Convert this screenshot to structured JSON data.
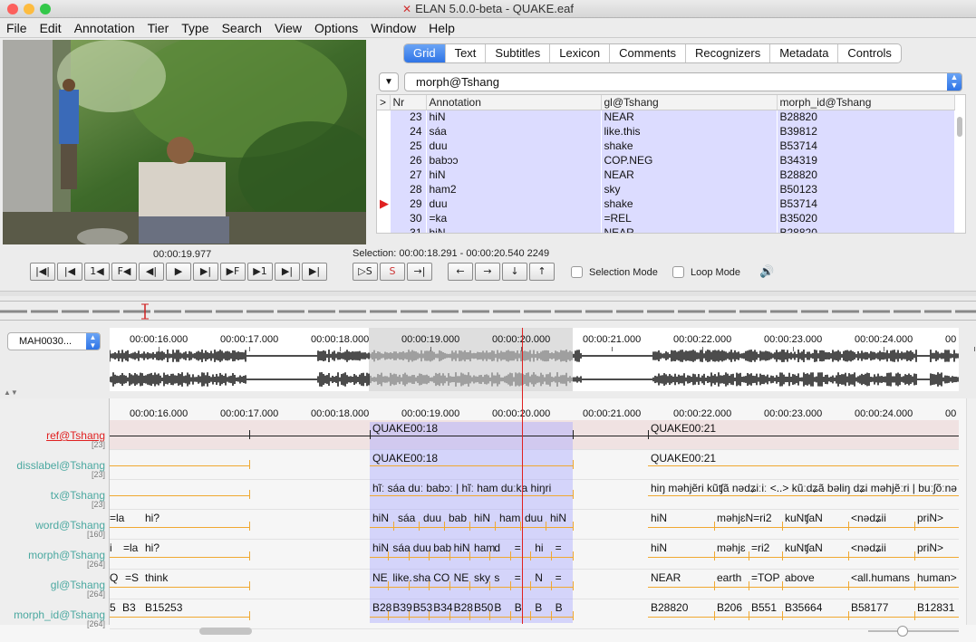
{
  "window": {
    "title": "ELAN 5.0.0-beta - QUAKE.eaf"
  },
  "menu": [
    "File",
    "Edit",
    "Annotation",
    "Tier",
    "Type",
    "Search",
    "View",
    "Options",
    "Window",
    "Help"
  ],
  "player": {
    "time": "00:00:19.977",
    "selection": "Selection: 00:00:18.291 - 00:00:20.540  2249"
  },
  "controls": {
    "buttons": [
      "|◀|",
      "|◀",
      "1◀",
      "F◀",
      "◀|",
      "▶",
      "▶|",
      "▶F",
      "▶1",
      "▶|",
      "▶|"
    ],
    "selection_buttons": [
      "▷S",
      "S",
      "→|"
    ],
    "arrow_buttons": [
      "←",
      "→",
      "↓",
      "↑"
    ],
    "selection_mode": "Selection Mode",
    "loop_mode": "Loop Mode"
  },
  "tabs": [
    "Grid",
    "Text",
    "Subtitles",
    "Lexicon",
    "Comments",
    "Recognizers",
    "Metadata",
    "Controls"
  ],
  "grid": {
    "tier": "morph@Tshang",
    "columns": [
      ">",
      "Nr",
      "Annotation",
      "gl@Tshang",
      "morph_id@Tshang"
    ],
    "rows": [
      {
        "nr": "23",
        "ann": "hiN",
        "gl": "NEAR",
        "id": "B28820",
        "current": false
      },
      {
        "nr": "24",
        "ann": "sáa",
        "gl": "like.this",
        "id": "B39812",
        "current": false
      },
      {
        "nr": "25",
        "ann": "duu",
        "gl": "shake",
        "id": "B53714",
        "current": false
      },
      {
        "nr": "26",
        "ann": "babɔɔ",
        "gl": "COP.NEG",
        "id": "B34319",
        "current": false
      },
      {
        "nr": "27",
        "ann": "hiN",
        "gl": "NEAR",
        "id": "B28820",
        "current": false
      },
      {
        "nr": "28",
        "ann": "ham2",
        "gl": "sky",
        "id": "B50123",
        "current": false
      },
      {
        "nr": "29",
        "ann": "duu",
        "gl": "shake",
        "id": "B53714",
        "current": true
      },
      {
        "nr": "30",
        "ann": "=ka",
        "gl": "=REL",
        "id": "B35020",
        "current": false
      },
      {
        "nr": "31",
        "ann": "hiN",
        "gl": "NEAR",
        "id": "B28820",
        "current": false
      }
    ]
  },
  "media_select": "MAH0030...",
  "ruler": [
    "00:00:16.000",
    "00:00:17.000",
    "00:00:18.000",
    "00:00:19.000",
    "00:00:20.000",
    "00:00:21.000",
    "00:00:22.000",
    "00:00:23.000",
    "00:00:24.000",
    "00"
  ],
  "tiers": [
    {
      "name": "ref@Tshang",
      "count": "[23]"
    },
    {
      "name": "disslabel@Tshang",
      "count": "[23]"
    },
    {
      "name": "tx@Tshang",
      "count": "[23]"
    },
    {
      "name": "word@Tshang",
      "count": "[160]"
    },
    {
      "name": "morph@Tshang",
      "count": "[264]"
    },
    {
      "name": "gl@Tshang",
      "count": "[264]"
    },
    {
      "name": "morph_id@Tshang",
      "count": "[264]"
    }
  ],
  "annotations": {
    "ref": [
      "QUAKE00:18",
      "QUAKE00:21"
    ],
    "diss": [
      "QUAKE00:18",
      "QUAKE00:21"
    ],
    "tx": [
      "hĩː sáa duː babɔː | hĩː ham duːka hiŋri",
      "hiŋ məhjẽri kũʧã nədʑiːiː <..> kũːdʑã bəliŋ dʑi məhjẽːri | buːʃõːnə"
    ],
    "word_left": [
      "=la",
      "hi?"
    ],
    "word_sel": [
      "hiN",
      "sáa",
      "duu",
      "bab",
      "hiN",
      "ham",
      "duu",
      "hiN"
    ],
    "word_right": [
      "hiN",
      "məhjɛN=ri2",
      "kuNʧaN",
      "<nədʑii",
      "priN>"
    ],
    "morph_left": [
      "i",
      "=la",
      "hi?"
    ],
    "morph_sel": [
      "hiN",
      "sáa",
      "duu",
      "bab",
      "hiN",
      "ham",
      "d",
      "=",
      "hi",
      "="
    ],
    "morph_right": [
      "hiN",
      "məhjɛ",
      "=ri2",
      "kuNʧaN",
      "<nədʑii",
      "priN>"
    ],
    "gl_left": [
      "Q",
      "=S",
      "think"
    ],
    "gl_sel": [
      "NE",
      "like.",
      "sha",
      "CO",
      "NE",
      "sky",
      "s",
      "=",
      "N",
      "="
    ],
    "gl_right": [
      "NEAR",
      "earth",
      "=TOP",
      "above",
      "<all.humans",
      "human>"
    ],
    "id_left": [
      "5",
      "B3",
      "B15253"
    ],
    "id_sel": [
      "B28",
      "B39",
      "B53",
      "B34",
      "B28",
      "B50",
      "B",
      "B",
      "B",
      "B"
    ],
    "id_right": [
      "B28820",
      "B206",
      "B551",
      "B35664",
      "B58177",
      "B12831"
    ]
  },
  "colors": {
    "selection": "#aaaaff",
    "cursor": "#e02020",
    "tier_current": "#e02020",
    "tier_name": "#4aa8a0",
    "underline": "#f0a830"
  }
}
